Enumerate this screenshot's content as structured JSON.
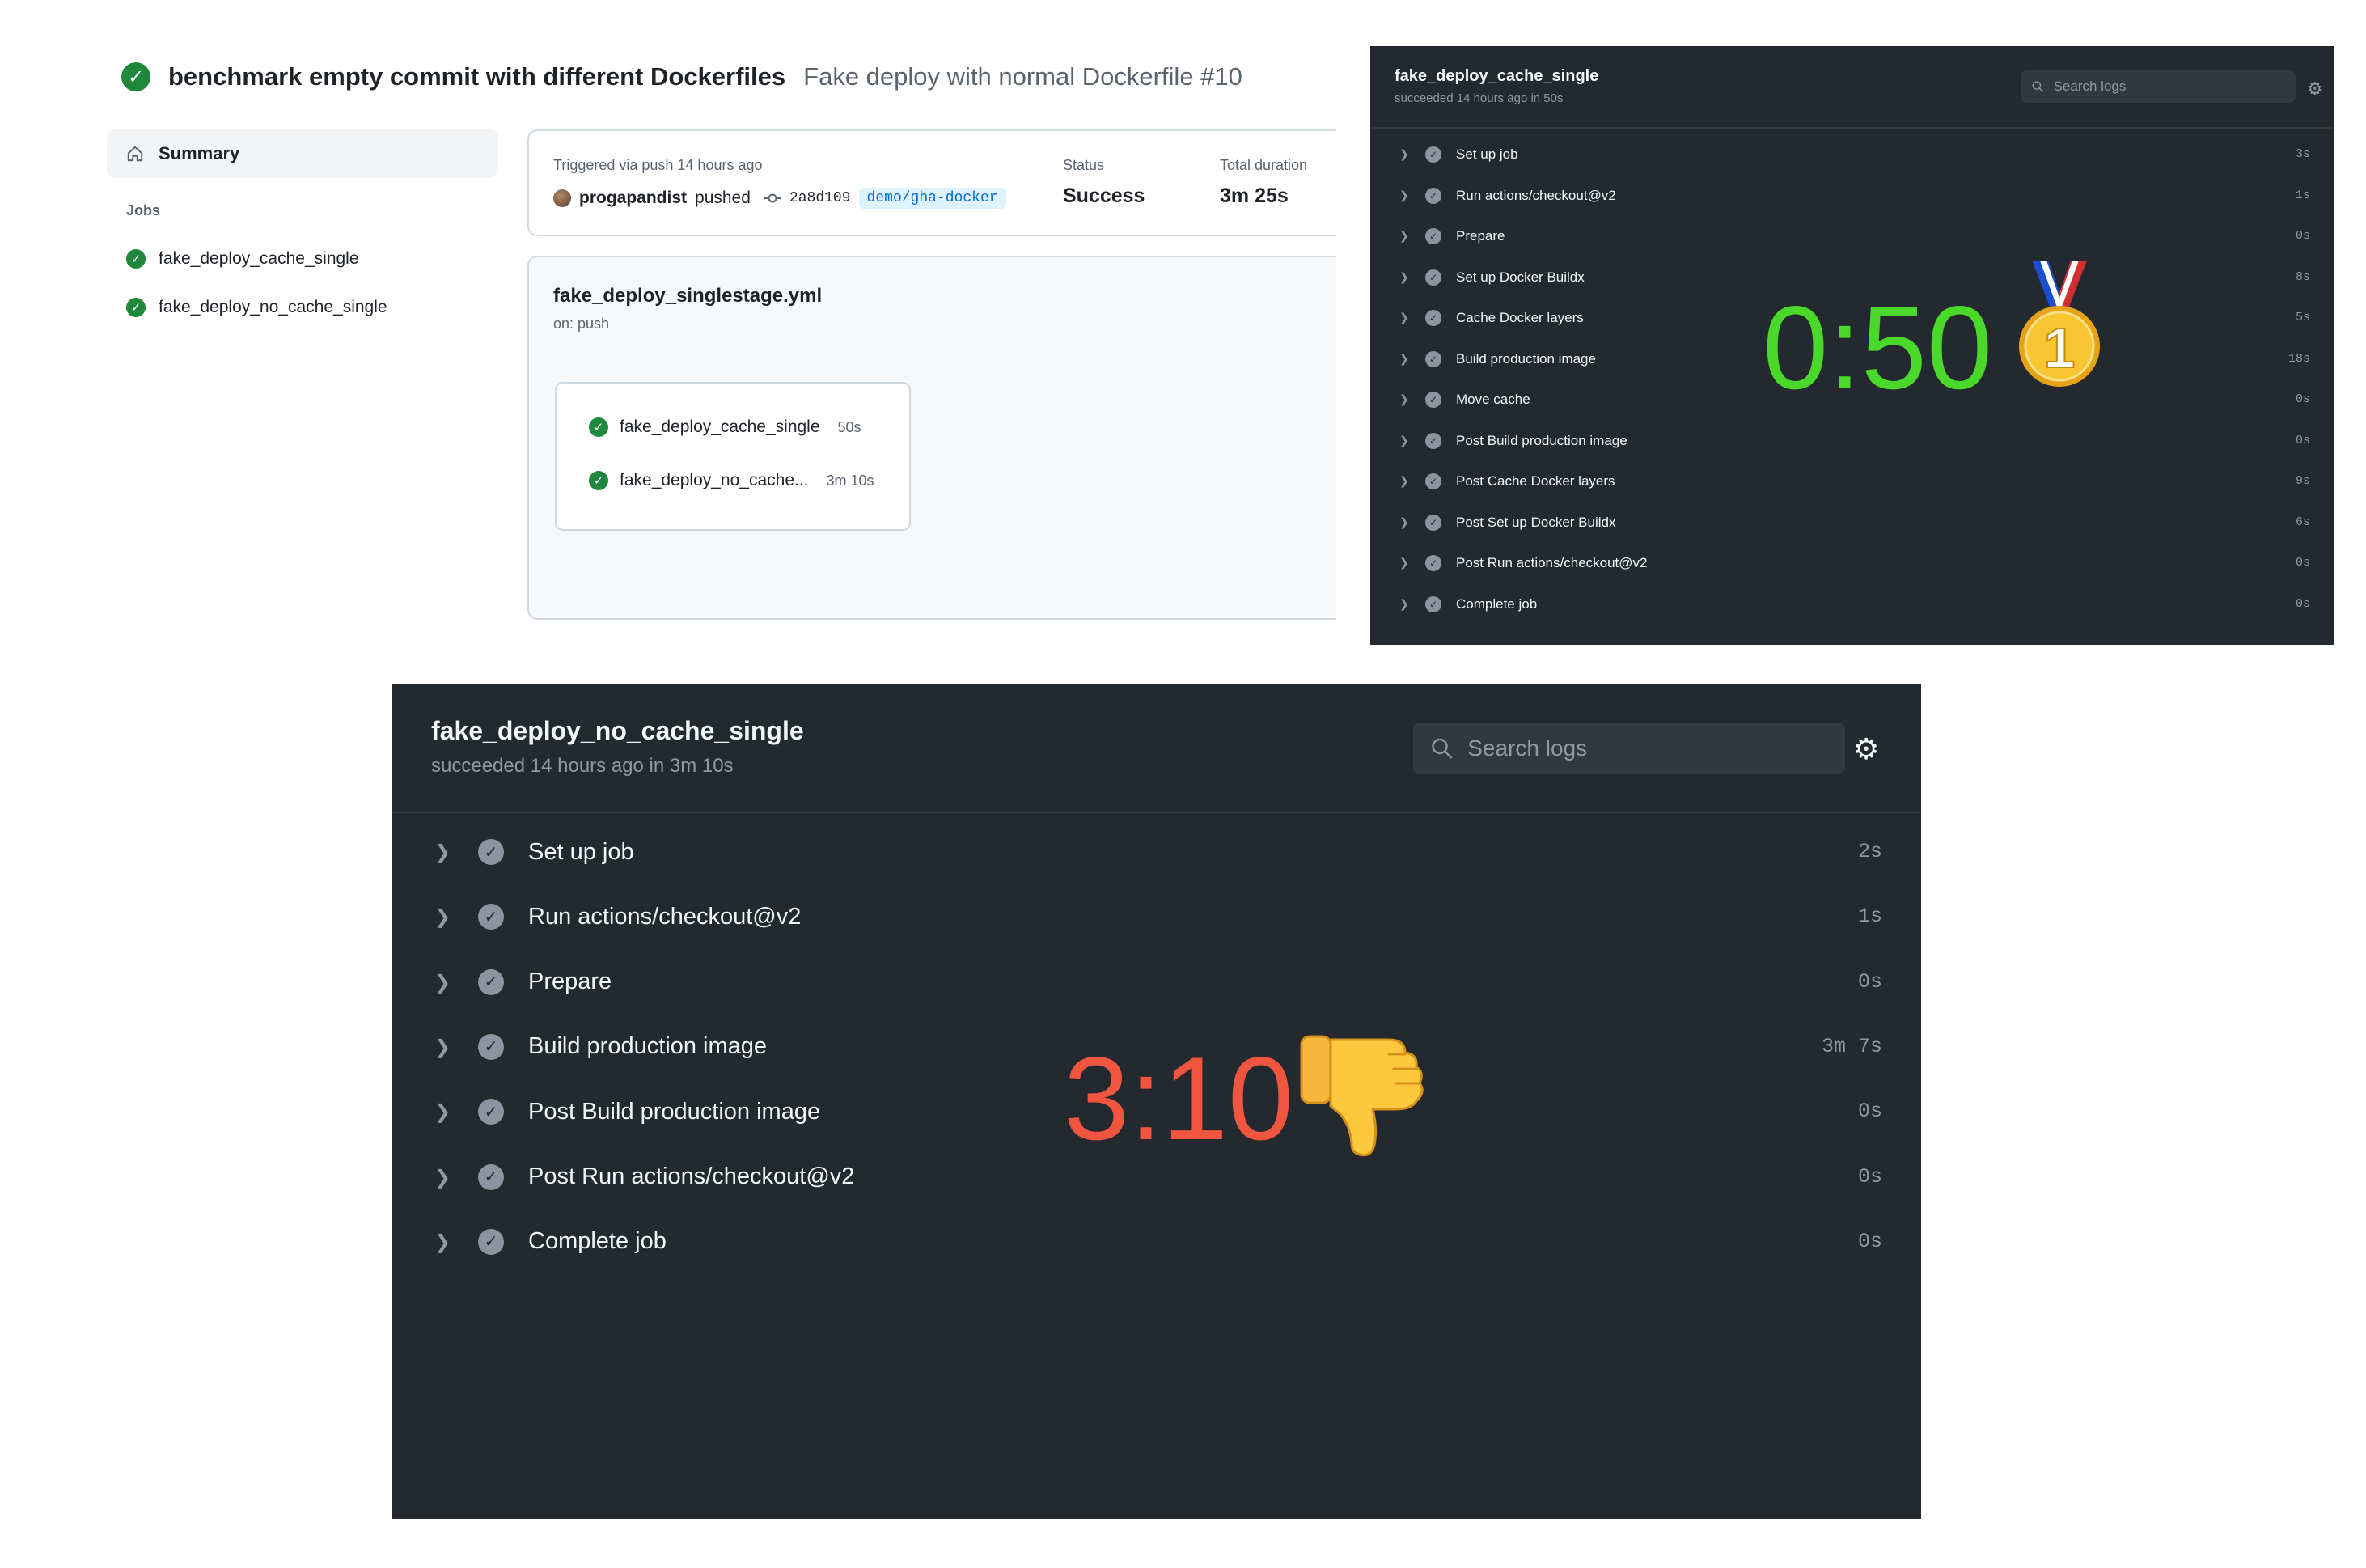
{
  "run": {
    "workflow_title": "benchmark empty commit with different Dockerfiles",
    "run_name": "Fake deploy with normal Dockerfile #10"
  },
  "sidebar": {
    "summary_label": "Summary",
    "jobs_heading": "Jobs",
    "jobs": [
      {
        "name": "fake_deploy_cache_single",
        "status": "success"
      },
      {
        "name": "fake_deploy_no_cache_single",
        "status": "success"
      }
    ]
  },
  "trigger": {
    "triggered_text": "Triggered via push 14 hours ago",
    "actor": "progapandist",
    "action": "pushed",
    "commit": "2a8d109",
    "branch": "demo/gha-docker",
    "status_label": "Status",
    "status_value": "Success",
    "duration_label": "Total duration",
    "duration_value": "3m 25s"
  },
  "workflow": {
    "file": "fake_deploy_singlestage.yml",
    "on": "on: push",
    "graph_jobs": [
      {
        "name": "fake_deploy_cache_single",
        "duration": "50s"
      },
      {
        "name": "fake_deploy_no_cache...",
        "duration": "3m 10s"
      }
    ]
  },
  "job_cache": {
    "title": "fake_deploy_cache_single",
    "subtitle": "succeeded 14 hours ago in 50s",
    "search_placeholder": "Search logs",
    "steps": [
      {
        "name": "Set up job",
        "duration": "3s"
      },
      {
        "name": "Run actions/checkout@v2",
        "duration": "1s"
      },
      {
        "name": "Prepare",
        "duration": "0s"
      },
      {
        "name": "Set up Docker Buildx",
        "duration": "8s"
      },
      {
        "name": "Cache Docker layers",
        "duration": "5s"
      },
      {
        "name": "Build production image",
        "duration": "18s"
      },
      {
        "name": "Move cache",
        "duration": "0s"
      },
      {
        "name": "Post Build production image",
        "duration": "0s"
      },
      {
        "name": "Post Cache Docker layers",
        "duration": "9s"
      },
      {
        "name": "Post Set up Docker Buildx",
        "duration": "6s"
      },
      {
        "name": "Post Run actions/checkout@v2",
        "duration": "0s"
      },
      {
        "name": "Complete job",
        "duration": "0s"
      }
    ],
    "overlay_time": "0:50",
    "overlay_color": "#4ad92a",
    "overlay_icon": "first-place-medal-icon"
  },
  "job_nocache": {
    "title": "fake_deploy_no_cache_single",
    "subtitle": "succeeded 14 hours ago in 3m 10s",
    "search_placeholder": "Search logs",
    "steps": [
      {
        "name": "Set up job",
        "duration": "2s"
      },
      {
        "name": "Run actions/checkout@v2",
        "duration": "1s"
      },
      {
        "name": "Prepare",
        "duration": "0s"
      },
      {
        "name": "Build production image",
        "duration": "3m 7s"
      },
      {
        "name": "Post Build production image",
        "duration": "0s"
      },
      {
        "name": "Post Run actions/checkout@v2",
        "duration": "0s"
      },
      {
        "name": "Complete job",
        "duration": "0s"
      }
    ],
    "overlay_time": "3:10",
    "overlay_color": "#f0553f",
    "overlay_icon": "thumbs-down-icon"
  },
  "colors": {
    "success_green": "#1f883d",
    "panel_dark": "#24292f",
    "link_blue": "#0969da"
  }
}
